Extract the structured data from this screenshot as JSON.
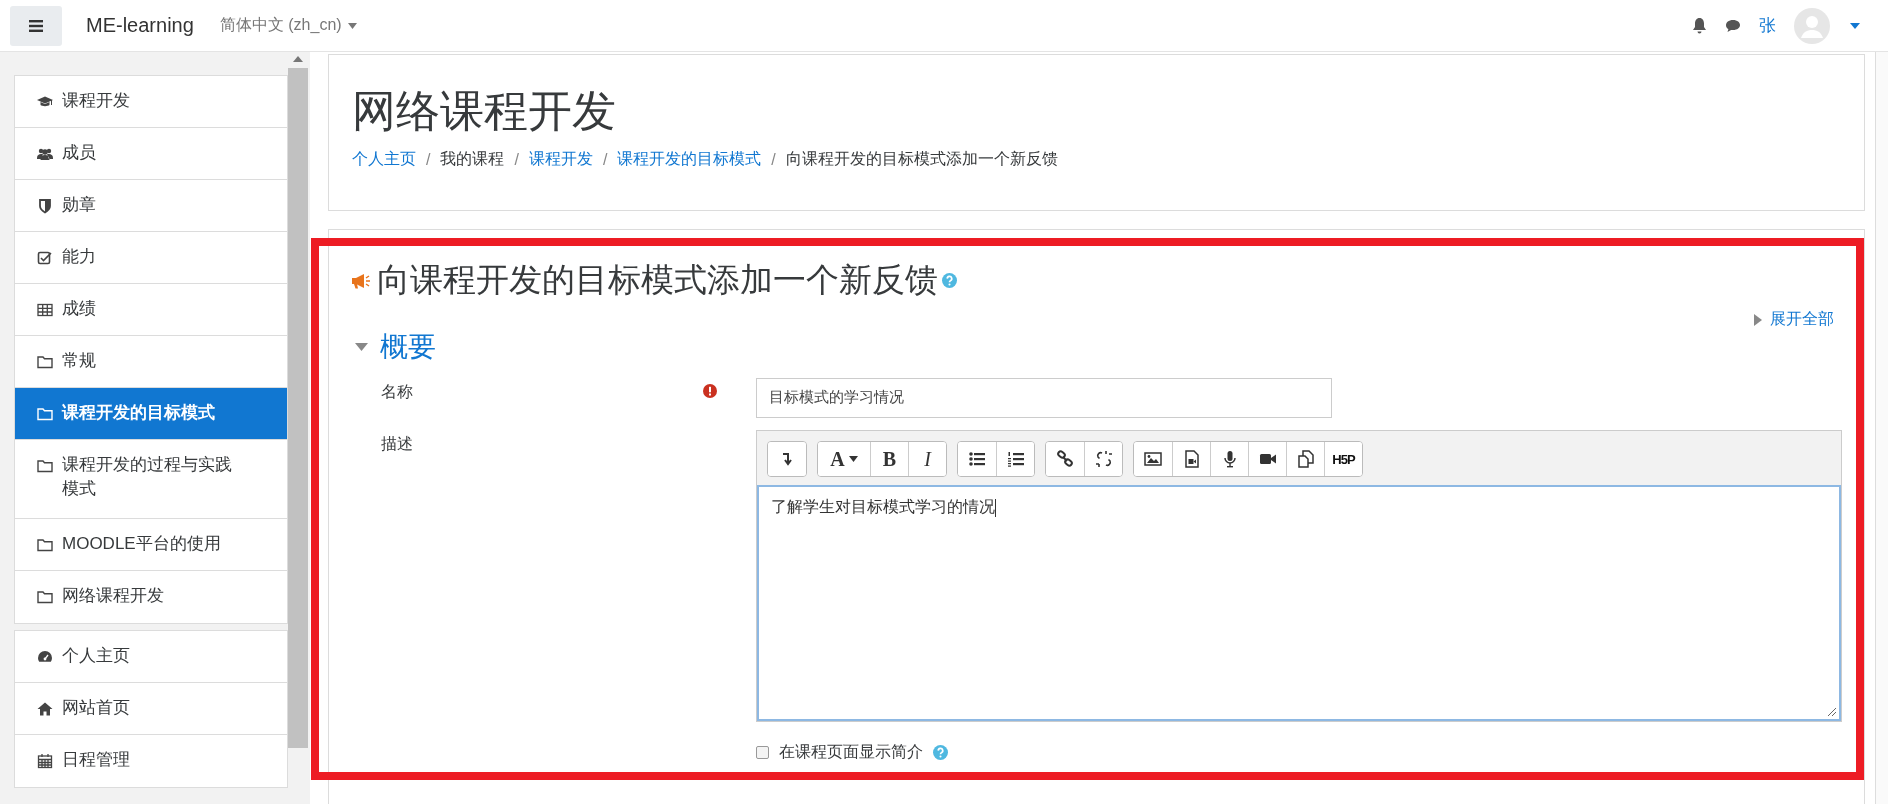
{
  "navbar": {
    "brand": "ME-learning",
    "language": "简体中文 (zh_cn)",
    "user_name": "张"
  },
  "sidebar": {
    "groups": [
      [
        {
          "label": "课程开发",
          "kind": "course",
          "selected": false
        },
        {
          "label": "成员",
          "kind": "participants",
          "selected": false
        },
        {
          "label": "勋章",
          "kind": "badges",
          "selected": false
        },
        {
          "label": "能力",
          "kind": "competencies",
          "selected": false
        },
        {
          "label": "成绩",
          "kind": "grades",
          "selected": false
        },
        {
          "label": "常规",
          "kind": "section",
          "selected": false
        },
        {
          "label": "课程开发的目标模式",
          "kind": "section",
          "selected": true
        },
        {
          "label": "课程开发的过程与实践模式",
          "kind": "section",
          "selected": false
        },
        {
          "label": "MOODLE平台的使用",
          "kind": "section",
          "selected": false
        },
        {
          "label": "网络课程开发",
          "kind": "section",
          "selected": false
        }
      ],
      [
        {
          "label": "个人主页",
          "kind": "dashboard",
          "selected": false
        },
        {
          "label": "网站首页",
          "kind": "home",
          "selected": false
        },
        {
          "label": "日程管理",
          "kind": "calendar",
          "selected": false
        }
      ]
    ]
  },
  "page_header": {
    "title": "网络课程开发",
    "breadcrumb": [
      {
        "label": "个人主页",
        "link": true
      },
      {
        "separator": "/",
        "label": "我的课程",
        "link": false
      },
      {
        "separator": "/",
        "label": "课程开发",
        "link": true
      },
      {
        "separator": "/",
        "label": "课程开发的目标模式",
        "link": true
      },
      {
        "separator": "/",
        "label": "向课程开发的目标模式添加一个新反馈",
        "link": false
      }
    ]
  },
  "form": {
    "heading": "向课程开发的目标模式添加一个新反馈",
    "expand_all": "展开全部",
    "section": {
      "title": "概要",
      "expanded": true
    },
    "name_field": {
      "label": "名称",
      "required": true,
      "value": "目标模式的学习情况"
    },
    "description": {
      "label": "描述",
      "value": "了解学生对目标模式学习的情况",
      "toolbar": [
        [
          {
            "kind": "more"
          }
        ],
        [
          {
            "kind": "font",
            "label": "A"
          },
          {
            "kind": "bold",
            "label": "B"
          },
          {
            "kind": "italic",
            "label": "I"
          }
        ],
        [
          {
            "kind": "bullets"
          },
          {
            "kind": "numbers"
          }
        ],
        [
          {
            "kind": "link"
          },
          {
            "kind": "unlink"
          }
        ],
        [
          {
            "kind": "image"
          },
          {
            "kind": "media"
          },
          {
            "kind": "audio"
          },
          {
            "kind": "video"
          },
          {
            "kind": "copy"
          },
          {
            "kind": "h5p",
            "label": "H5P"
          }
        ]
      ]
    },
    "show_description": {
      "label": "在课程页面显示简介",
      "checked": false
    }
  }
}
